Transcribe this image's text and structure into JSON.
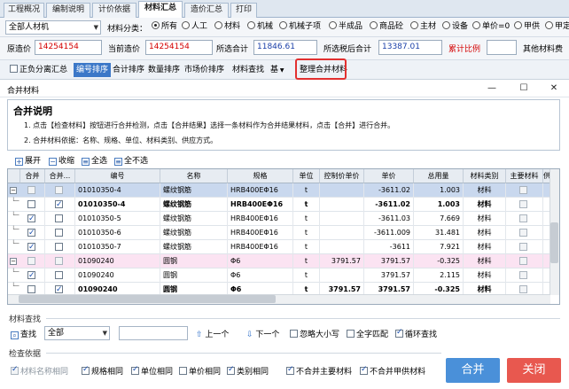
{
  "tabs": [
    "工程概况",
    "编制说明",
    "计价依据",
    "材料汇总",
    "造价汇总",
    "打印"
  ],
  "active_tab": "材料汇总",
  "filter": {
    "scope_value": "全部人材机",
    "class_label": "材料分类：",
    "options": [
      "所有",
      "人工",
      "材料",
      "机械",
      "机械子项",
      "半成品",
      "商品砼",
      "主材",
      "设备",
      "单价=0",
      "甲供",
      "甲定"
    ],
    "selected": "所有"
  },
  "price": {
    "orig_label": "原造价",
    "orig_value": "14254154",
    "cur_label": "当前造价",
    "cur_value": "14254154",
    "total_label": "所选合计",
    "total_value": "11846.61",
    "after_tax_label": "所选税后合计",
    "after_tax_value": "13387.01",
    "ratio_label": "累计比例",
    "other_label": "其他材料费"
  },
  "toolbar": {
    "items": [
      "正负分离汇总",
      "编号排序",
      "合计排序",
      "数量排序",
      "市场价排序",
      "材料查找",
      "基",
      "整理合并材料"
    ],
    "selected": "编号排序"
  },
  "dialog": {
    "title": "合并材料",
    "explain_title": "合并说明",
    "explain_line1": "1. 点击【检查材料】按钮进行合并检测，点击【合并结果】选择一条材料作为合并结果材料，点击【合并】进行合并。",
    "explain_line2": "2. 合并材料依据：名称、规格、单位、材料类别、供应方式。",
    "grid_tools": [
      "展开",
      "收缩",
      "全选",
      "全不选"
    ]
  },
  "grid": {
    "columns": [
      "合并",
      "合并...",
      "编号",
      "名称",
      "规格",
      "单位",
      "控制价单价",
      "单价",
      "总用量",
      "材料类别",
      "主要材料",
      "供"
    ],
    "rows": [
      {
        "group": true,
        "merge": false,
        "result": false,
        "code": "01010350-4",
        "name": "螺纹钢筋",
        "spec": "HRB400EΦ16",
        "unit": "t",
        "ctrl": "",
        "price": "-3611.02",
        "qty": "1.003",
        "cat": "材料",
        "bold": false,
        "tone": "blue"
      },
      {
        "group": false,
        "merge": false,
        "result": true,
        "code": "01010350-4",
        "name": "螺纹钢筋",
        "spec": "HRB400EΦ16",
        "unit": "t",
        "ctrl": "",
        "price": "-3611.02",
        "qty": "1.003",
        "cat": "材料",
        "bold": true,
        "tone": "none"
      },
      {
        "group": false,
        "merge": true,
        "result": false,
        "code": "01010350-5",
        "name": "螺纹钢筋",
        "spec": "HRB400EΦ16",
        "unit": "t",
        "ctrl": "",
        "price": "-3611.03",
        "qty": "7.669",
        "cat": "材料",
        "bold": false,
        "tone": "none"
      },
      {
        "group": false,
        "merge": true,
        "result": false,
        "code": "01010350-6",
        "name": "螺纹钢筋",
        "spec": "HRB400EΦ16",
        "unit": "t",
        "ctrl": "",
        "price": "-3611.009",
        "qty": "31.481",
        "cat": "材料",
        "bold": false,
        "tone": "none"
      },
      {
        "group": false,
        "merge": true,
        "result": false,
        "code": "01010350-7",
        "name": "螺纹钢筋",
        "spec": "HRB400EΦ16",
        "unit": "t",
        "ctrl": "",
        "price": "-3611",
        "qty": "7.921",
        "cat": "材料",
        "bold": false,
        "tone": "none"
      },
      {
        "group": true,
        "merge": false,
        "result": false,
        "code": "01090240",
        "name": "圆钢",
        "spec": "Φ6",
        "unit": "t",
        "ctrl": "3791.57",
        "price": "3791.57",
        "qty": "-0.325",
        "cat": "材料",
        "bold": false,
        "tone": "pink"
      },
      {
        "group": false,
        "merge": true,
        "result": false,
        "code": "01090240",
        "name": "圆钢",
        "spec": "Φ6",
        "unit": "t",
        "ctrl": "",
        "price": "3791.57",
        "qty": "2.115",
        "cat": "材料",
        "bold": false,
        "tone": "none"
      },
      {
        "group": false,
        "merge": false,
        "result": true,
        "code": "01090240",
        "name": "圆钢",
        "spec": "Φ6",
        "unit": "t",
        "ctrl": "3791.57",
        "price": "3791.57",
        "qty": "-0.325",
        "cat": "材料",
        "bold": true,
        "tone": "none"
      }
    ]
  },
  "search": {
    "section_label": "材料查找",
    "find_label": "查找",
    "scope_value": "全部",
    "query_value": "",
    "prev_label": "上一个",
    "next_label": "下一个",
    "ignore_case_label": "忽略大小写",
    "whole_match_label": "全字匹配",
    "loop_label": "循环查找",
    "ignore_case": false,
    "whole_match": false,
    "loop": true
  },
  "criteria": {
    "section_label": "检查依据",
    "items": [
      {
        "label": "材料名称相同",
        "checked": true,
        "dim": true
      },
      {
        "label": "规格相同",
        "checked": true,
        "dim": false
      },
      {
        "label": "单位相同",
        "checked": true,
        "dim": false
      },
      {
        "label": "单价相同",
        "checked": false,
        "dim": false
      },
      {
        "label": "类别相同",
        "checked": true,
        "dim": false
      },
      {
        "label": "不合并主要材料",
        "checked": true,
        "dim": false
      },
      {
        "label": "不合并甲供材料",
        "checked": true,
        "dim": false
      }
    ]
  },
  "buttons": {
    "merge": "合并",
    "close": "关闭"
  }
}
